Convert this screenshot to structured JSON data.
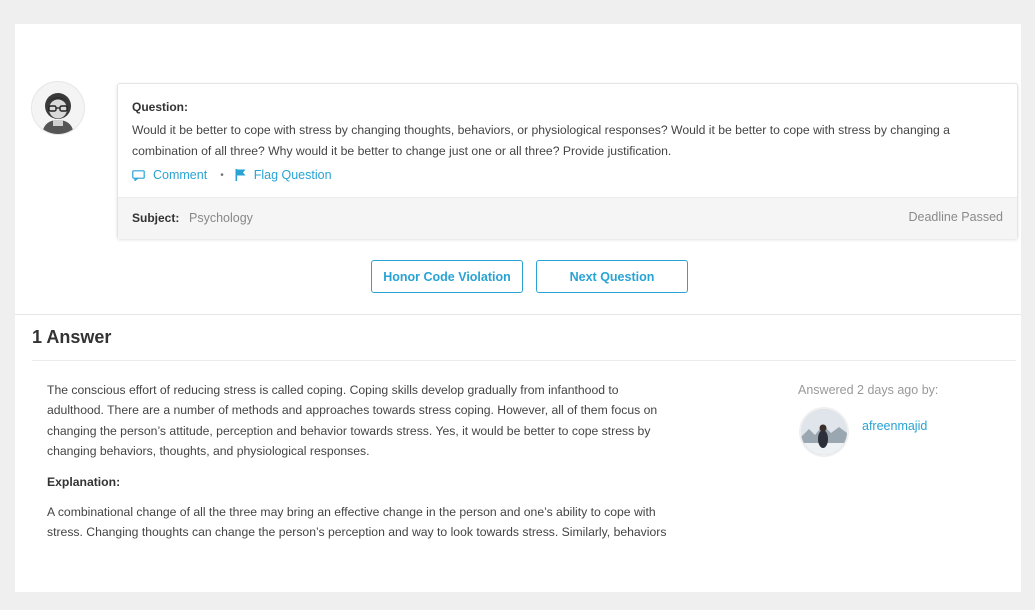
{
  "question": {
    "label": "Question:",
    "line1": "Would it be better to cope with stress by changing thoughts, behaviors, or physiological responses? Would it be better to cope with stress by changing a",
    "line2": "combination of all three? Why would it be better to change just one or all three? Provide justification.",
    "comment_label": "Comment",
    "separator": "•",
    "flag_label": "Flag Question",
    "subject_label": "Subject:",
    "subject_value": "Psychology",
    "deadline": "Deadline Passed"
  },
  "buttons": {
    "honor_code": "Honor Code Violation",
    "next_question": "Next Question"
  },
  "answers": {
    "heading": "1 Answer",
    "paragraph1": [
      "The conscious effort of reducing stress is called coping. Coping skills develop gradually from infanthood to",
      "adulthood. There are a number of methods and approaches towards stress coping. However, all of them focus on",
      "changing the person’s attitude, perception and behavior towards stress. Yes, it would be better to cope stress by",
      "changing behaviors, thoughts, and physiological responses."
    ],
    "explanation_label": "Explanation:",
    "paragraph2": [
      "A combinational change of all the three may bring an effective change in the person and one’s ability to cope with",
      "stress. Changing thoughts can change the person’s perception and way to look towards stress. Similarly, behaviors"
    ],
    "answered_by": "Answered 2 days ago by:",
    "username": "afreenmajid"
  },
  "icons": {
    "comment": "comment-icon",
    "flag": "flag-icon",
    "asker_avatar": "user-avatar-icon",
    "answerer_avatar": "user-photo"
  },
  "colors": {
    "accent": "#29a3d4",
    "background": "#efefef",
    "card": "#ffffff",
    "footer": "#f5f5f5"
  }
}
